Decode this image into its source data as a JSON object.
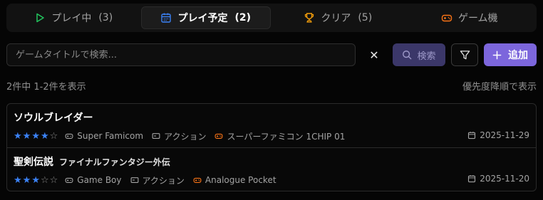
{
  "tabs": [
    {
      "label": "プレイ中",
      "count": "(3)",
      "icon": "play-icon",
      "color": "#22c55e",
      "active": false
    },
    {
      "label": "プレイ予定",
      "count": "(2)",
      "icon": "calendar-icon",
      "color": "#3b82f6",
      "active": true
    },
    {
      "label": "クリア",
      "count": "(5)",
      "icon": "trophy-icon",
      "color": "#f59e0b",
      "active": false
    },
    {
      "label": "ゲーム機",
      "count": "",
      "icon": "gamepad-icon",
      "color": "#f97316",
      "active": false
    }
  ],
  "search": {
    "placeholder": "ゲームタイトルで検索...",
    "value": "",
    "clear_label": "✕",
    "button_label": "検索",
    "add_label": "追加"
  },
  "info": {
    "result_count": "2件中 1-2件を表示",
    "sort_label": "優先度降順で表示"
  },
  "colors": {
    "accent": "#7c66dc",
    "star": "#3b82f6",
    "platform_icon": "#f97316"
  },
  "games": [
    {
      "title": "ソウルブレイダー",
      "subtitle": "",
      "rating": 4,
      "max_rating": 5,
      "console": "Super Famicom",
      "genre": "アクション",
      "platform": "スーパーファミコン 1CHIP 01",
      "date": "2025-11-29"
    },
    {
      "title": "聖剣伝説",
      "subtitle": "ファイナルファンタジー外伝",
      "rating": 3,
      "max_rating": 5,
      "console": "Game Boy",
      "genre": "アクション",
      "platform": "Analogue Pocket",
      "date": "2025-11-20"
    }
  ]
}
